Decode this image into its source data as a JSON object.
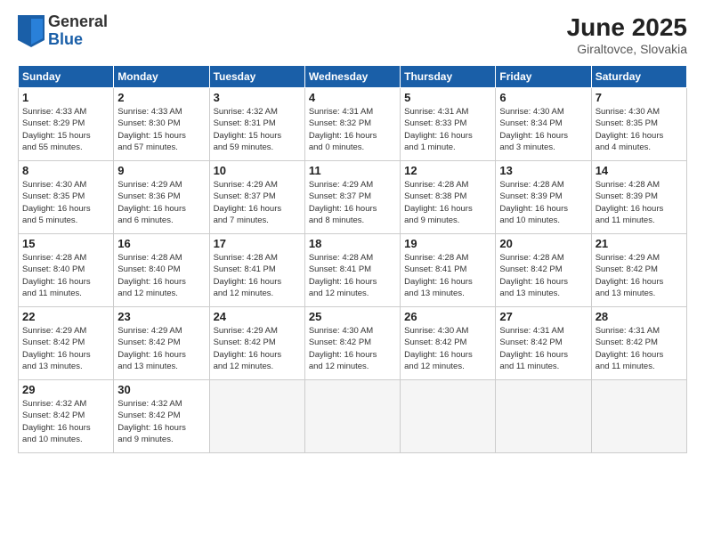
{
  "header": {
    "logo_general": "General",
    "logo_blue": "Blue",
    "month_title": "June 2025",
    "location": "Giraltovce, Slovakia"
  },
  "weekdays": [
    "Sunday",
    "Monday",
    "Tuesday",
    "Wednesday",
    "Thursday",
    "Friday",
    "Saturday"
  ],
  "weeks": [
    [
      {
        "day": "1",
        "info": "Sunrise: 4:33 AM\nSunset: 8:29 PM\nDaylight: 15 hours\nand 55 minutes."
      },
      {
        "day": "2",
        "info": "Sunrise: 4:33 AM\nSunset: 8:30 PM\nDaylight: 15 hours\nand 57 minutes."
      },
      {
        "day": "3",
        "info": "Sunrise: 4:32 AM\nSunset: 8:31 PM\nDaylight: 15 hours\nand 59 minutes."
      },
      {
        "day": "4",
        "info": "Sunrise: 4:31 AM\nSunset: 8:32 PM\nDaylight: 16 hours\nand 0 minutes."
      },
      {
        "day": "5",
        "info": "Sunrise: 4:31 AM\nSunset: 8:33 PM\nDaylight: 16 hours\nand 1 minute."
      },
      {
        "day": "6",
        "info": "Sunrise: 4:30 AM\nSunset: 8:34 PM\nDaylight: 16 hours\nand 3 minutes."
      },
      {
        "day": "7",
        "info": "Sunrise: 4:30 AM\nSunset: 8:35 PM\nDaylight: 16 hours\nand 4 minutes."
      }
    ],
    [
      {
        "day": "8",
        "info": "Sunrise: 4:30 AM\nSunset: 8:35 PM\nDaylight: 16 hours\nand 5 minutes."
      },
      {
        "day": "9",
        "info": "Sunrise: 4:29 AM\nSunset: 8:36 PM\nDaylight: 16 hours\nand 6 minutes."
      },
      {
        "day": "10",
        "info": "Sunrise: 4:29 AM\nSunset: 8:37 PM\nDaylight: 16 hours\nand 7 minutes."
      },
      {
        "day": "11",
        "info": "Sunrise: 4:29 AM\nSunset: 8:37 PM\nDaylight: 16 hours\nand 8 minutes."
      },
      {
        "day": "12",
        "info": "Sunrise: 4:28 AM\nSunset: 8:38 PM\nDaylight: 16 hours\nand 9 minutes."
      },
      {
        "day": "13",
        "info": "Sunrise: 4:28 AM\nSunset: 8:39 PM\nDaylight: 16 hours\nand 10 minutes."
      },
      {
        "day": "14",
        "info": "Sunrise: 4:28 AM\nSunset: 8:39 PM\nDaylight: 16 hours\nand 11 minutes."
      }
    ],
    [
      {
        "day": "15",
        "info": "Sunrise: 4:28 AM\nSunset: 8:40 PM\nDaylight: 16 hours\nand 11 minutes."
      },
      {
        "day": "16",
        "info": "Sunrise: 4:28 AM\nSunset: 8:40 PM\nDaylight: 16 hours\nand 12 minutes."
      },
      {
        "day": "17",
        "info": "Sunrise: 4:28 AM\nSunset: 8:41 PM\nDaylight: 16 hours\nand 12 minutes."
      },
      {
        "day": "18",
        "info": "Sunrise: 4:28 AM\nSunset: 8:41 PM\nDaylight: 16 hours\nand 12 minutes."
      },
      {
        "day": "19",
        "info": "Sunrise: 4:28 AM\nSunset: 8:41 PM\nDaylight: 16 hours\nand 13 minutes."
      },
      {
        "day": "20",
        "info": "Sunrise: 4:28 AM\nSunset: 8:42 PM\nDaylight: 16 hours\nand 13 minutes."
      },
      {
        "day": "21",
        "info": "Sunrise: 4:29 AM\nSunset: 8:42 PM\nDaylight: 16 hours\nand 13 minutes."
      }
    ],
    [
      {
        "day": "22",
        "info": "Sunrise: 4:29 AM\nSunset: 8:42 PM\nDaylight: 16 hours\nand 13 minutes."
      },
      {
        "day": "23",
        "info": "Sunrise: 4:29 AM\nSunset: 8:42 PM\nDaylight: 16 hours\nand 13 minutes."
      },
      {
        "day": "24",
        "info": "Sunrise: 4:29 AM\nSunset: 8:42 PM\nDaylight: 16 hours\nand 12 minutes."
      },
      {
        "day": "25",
        "info": "Sunrise: 4:30 AM\nSunset: 8:42 PM\nDaylight: 16 hours\nand 12 minutes."
      },
      {
        "day": "26",
        "info": "Sunrise: 4:30 AM\nSunset: 8:42 PM\nDaylight: 16 hours\nand 12 minutes."
      },
      {
        "day": "27",
        "info": "Sunrise: 4:31 AM\nSunset: 8:42 PM\nDaylight: 16 hours\nand 11 minutes."
      },
      {
        "day": "28",
        "info": "Sunrise: 4:31 AM\nSunset: 8:42 PM\nDaylight: 16 hours\nand 11 minutes."
      }
    ],
    [
      {
        "day": "29",
        "info": "Sunrise: 4:32 AM\nSunset: 8:42 PM\nDaylight: 16 hours\nand 10 minutes."
      },
      {
        "day": "30",
        "info": "Sunrise: 4:32 AM\nSunset: 8:42 PM\nDaylight: 16 hours\nand 9 minutes."
      },
      {
        "day": "",
        "info": ""
      },
      {
        "day": "",
        "info": ""
      },
      {
        "day": "",
        "info": ""
      },
      {
        "day": "",
        "info": ""
      },
      {
        "day": "",
        "info": ""
      }
    ]
  ]
}
